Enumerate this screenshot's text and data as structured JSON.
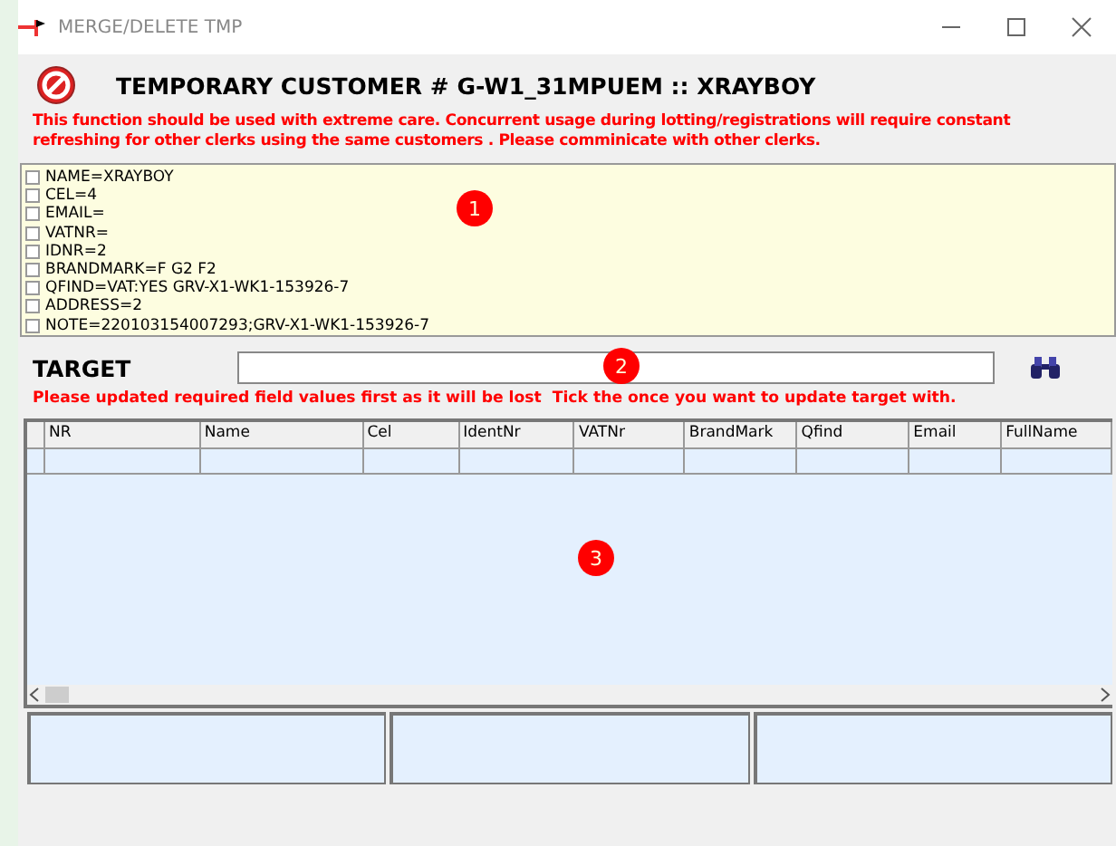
{
  "window": {
    "title": "MERGE/DELETE TMP"
  },
  "header": {
    "title": "TEMPORARY CUSTOMER # G-W1_31MPUEM :: XRAYBOY",
    "warning": "This function should be used with extreme care. Concurrent usage during lotting/registrations will require constant  refreshing for other clerks using the same customers . Please comminicate with other clerks."
  },
  "fields": [
    {
      "label": "NAME=XRAYBOY",
      "checked": false
    },
    {
      "label": "CEL=4",
      "checked": false
    },
    {
      "label": "EMAIL=",
      "checked": false
    },
    {
      "label": "VATNR=",
      "checked": false
    },
    {
      "label": "IDNR=2",
      "checked": false
    },
    {
      "label": "BRANDMARK=F G2 F2",
      "checked": false
    },
    {
      "label": "QFIND=VAT:YES GRV-X1-WK1-153926-7",
      "checked": false
    },
    {
      "label": "ADDRESS=2",
      "checked": false
    },
    {
      "label": "NOTE=220103154007293;GRV-X1-WK1-153926-7",
      "checked": false
    }
  ],
  "target": {
    "label": "TARGET",
    "hint": "Please updated required field values first as it will be lost  Tick the once you want to update target with."
  },
  "table": {
    "columns": [
      "NR",
      "Name",
      "Cel",
      "IdentNr",
      "VATNr",
      "BrandMark",
      "Qfind",
      "Email",
      "FullName"
    ]
  },
  "markers": [
    "1",
    "2",
    "3"
  ]
}
